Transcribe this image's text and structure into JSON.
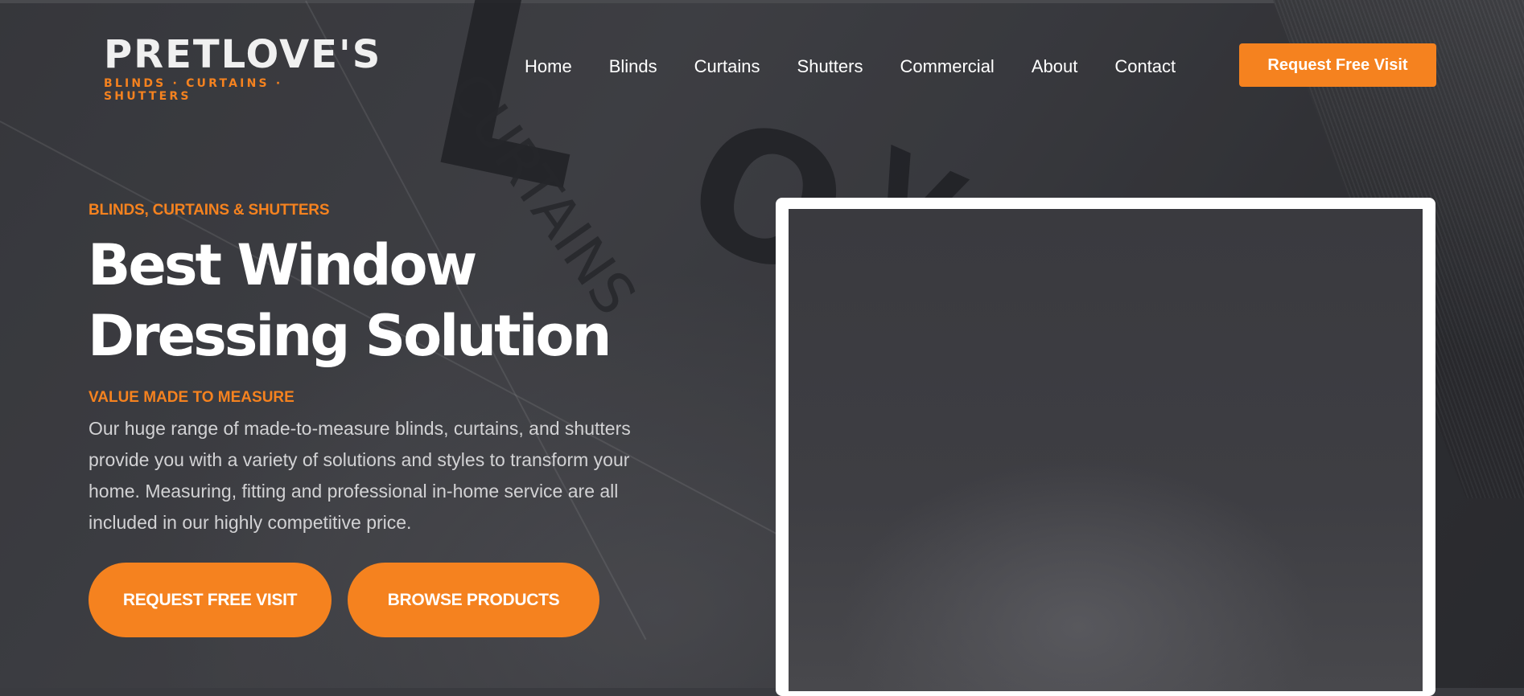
{
  "brand": {
    "name": "PRETLOVE'S",
    "tagline": "BLINDS · CURTAINS · SHUTTERS"
  },
  "nav": {
    "items": [
      "Home",
      "Blinds",
      "Curtains",
      "Shutters",
      "Commercial",
      "About",
      "Contact"
    ],
    "cta_label": "Request Free Visit"
  },
  "hero": {
    "eyebrow": "BLINDS, CURTAINS & SHUTTERS",
    "headline_line1": "Best Window",
    "headline_line2": "Dressing Solution",
    "subhead": "VALUE MADE TO MEASURE",
    "description": "Our huge range of made-to-measure blinds, curtains, and shutters provide you with a variety of solutions and styles to transform your home. Measuring, fitting and professional in-home service are all included in our highly competitive price.",
    "primary_button": "REQUEST FREE VISIT",
    "secondary_button": "BROWSE PRODUCTS"
  },
  "colors": {
    "accent": "#f5821f",
    "background": "#3a3b40",
    "text": "#ffffff"
  }
}
